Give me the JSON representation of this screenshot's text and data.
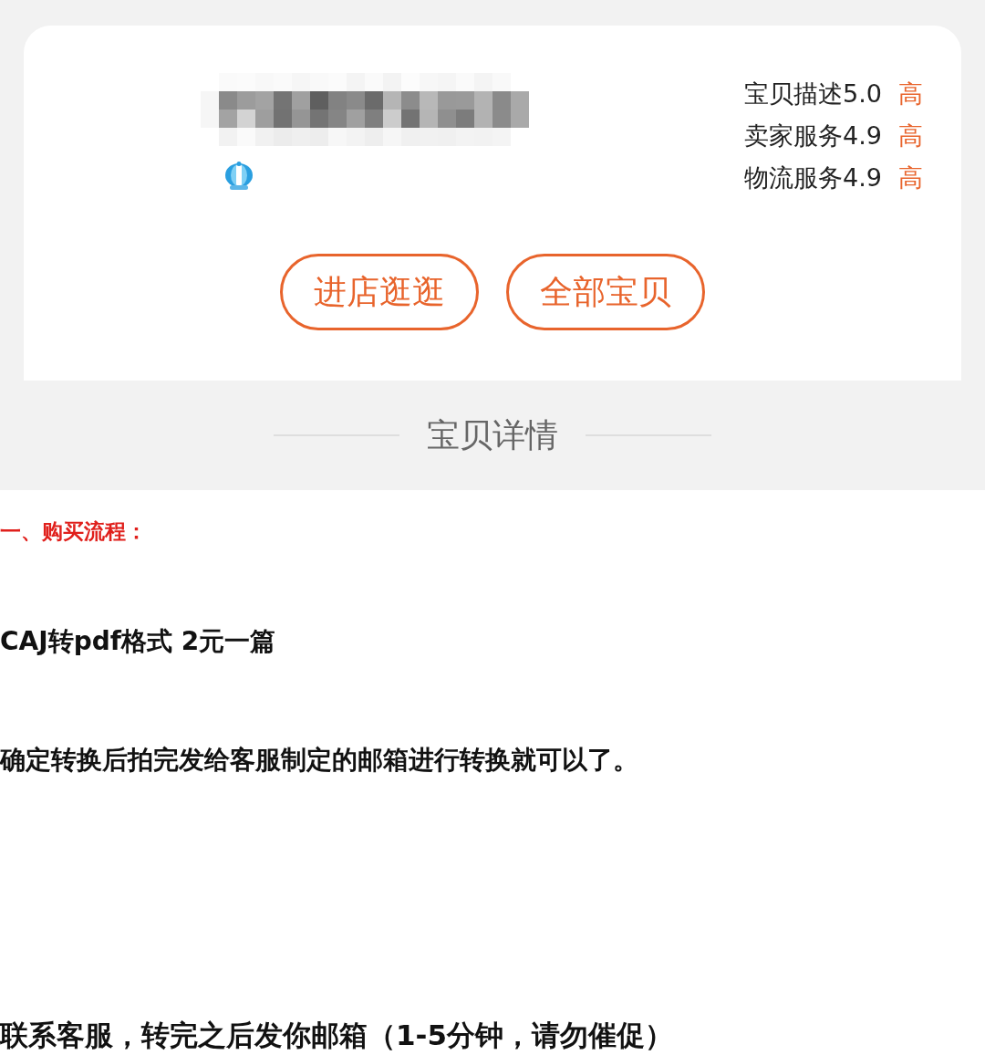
{
  "shop_card": {
    "ratings": [
      {
        "label": "宝贝描述5.0",
        "grade": "高"
      },
      {
        "label": "卖家服务4.9",
        "grade": "高"
      },
      {
        "label": "物流服务4.9",
        "grade": "高"
      }
    ],
    "buttons": [
      "进店逛逛",
      "全部宝贝"
    ]
  },
  "section_divider": {
    "title": "宝贝详情"
  },
  "details": [
    {
      "kind": "heading",
      "text": "一、购买流程："
    },
    {
      "kind": "paragraph",
      "text": "CAJ转pdf格式 2元一篇"
    },
    {
      "kind": "paragraph",
      "text": "确定转换后拍完发给客服制定的邮箱进行转换就可以了。"
    },
    {
      "kind": "paragraph",
      "text": "联系客服，转完之后发你邮箱（1-5分钟，请勿催促）"
    }
  ]
}
